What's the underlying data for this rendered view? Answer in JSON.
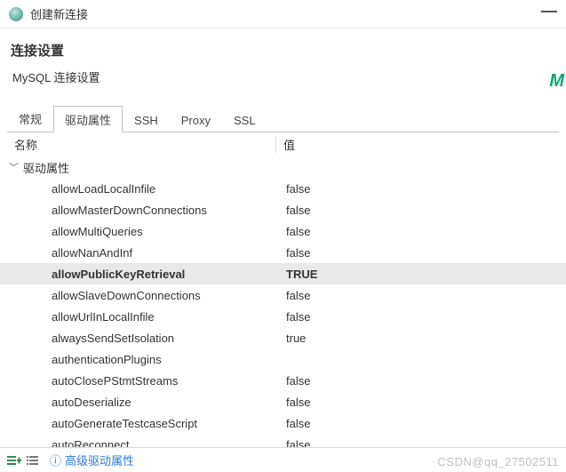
{
  "window": {
    "title": "创建新连接"
  },
  "header": {
    "section": "连接设置",
    "subtitle": "MySQL 连接设置"
  },
  "tabs": {
    "items": [
      {
        "label": "常规"
      },
      {
        "label": "驱动属性"
      },
      {
        "label": "SSH"
      },
      {
        "label": "Proxy"
      },
      {
        "label": "SSL"
      }
    ],
    "activeIndex": 1
  },
  "columns": {
    "name": "名称",
    "value": "值"
  },
  "group": {
    "label": "驱动属性"
  },
  "rows": [
    {
      "name": "allowLoadLocalInfile",
      "value": "false"
    },
    {
      "name": "allowMasterDownConnections",
      "value": "false"
    },
    {
      "name": "allowMultiQueries",
      "value": "false"
    },
    {
      "name": "allowNanAndInf",
      "value": "false"
    },
    {
      "name": "allowPublicKeyRetrieval",
      "value": "TRUE",
      "selected": true
    },
    {
      "name": "allowSlaveDownConnections",
      "value": "false"
    },
    {
      "name": "allowUrlInLocalInfile",
      "value": "false"
    },
    {
      "name": "alwaysSendSetIsolation",
      "value": "true"
    },
    {
      "name": "authenticationPlugins",
      "value": ""
    },
    {
      "name": "autoClosePStmtStreams",
      "value": "false"
    },
    {
      "name": "autoDeserialize",
      "value": "false"
    },
    {
      "name": "autoGenerateTestcaseScript",
      "value": "false"
    },
    {
      "name": "autoReconnect",
      "value": "false"
    }
  ],
  "footer": {
    "link": "高级驱动属性"
  },
  "watermark": "CSDN@qq_27502511",
  "brandLetter": "M"
}
